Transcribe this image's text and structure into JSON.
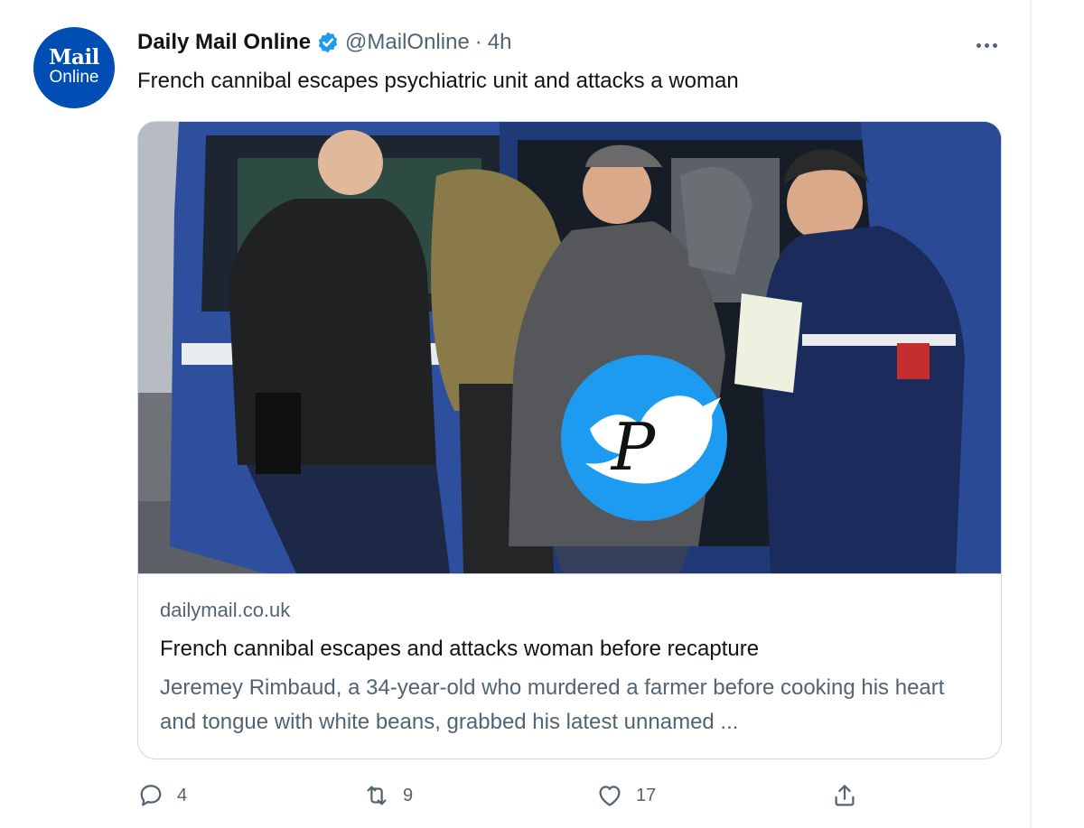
{
  "tweet": {
    "avatar": {
      "line1": "Mail",
      "line2": "Online"
    },
    "author_name": "Daily Mail Online",
    "handle": "@MailOnline",
    "separator": "·",
    "time": "4h",
    "text": "French cannibal escapes psychiatric unit and attacks a woman"
  },
  "card": {
    "domain": "dailymail.co.uk",
    "title": "French cannibal escapes and attacks woman before recapture",
    "description": "Jeremey Rimbaud, a 34-year-old who murdered a farmer before cooking his heart and tongue with white beans, grabbed his latest unnamed ...",
    "watermark_letter": "P"
  },
  "actions": {
    "replies": "4",
    "retweets": "9",
    "likes": "17"
  },
  "icons": {
    "verified": "verified-badge-icon",
    "more": "more-options-icon",
    "reply": "reply-icon",
    "retweet": "retweet-icon",
    "like": "like-icon",
    "share": "share-icon"
  },
  "colors": {
    "verified_blue": "#1d9bf0",
    "avatar_blue": "#004db3",
    "text_secondary": "#536471",
    "text_primary": "#0f1419",
    "van_blue": "#2e4f9e"
  }
}
